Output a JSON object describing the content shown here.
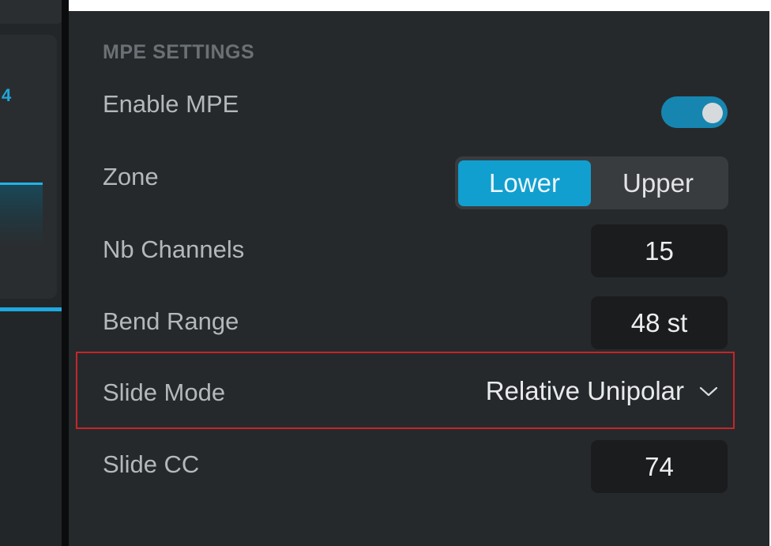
{
  "left_strip": {
    "visible_digit": "4"
  },
  "section": {
    "title": "MPE SETTINGS"
  },
  "rows": {
    "enable_mpe": {
      "label": "Enable MPE",
      "enabled": true
    },
    "zone": {
      "label": "Zone",
      "options": [
        "Lower",
        "Upper"
      ],
      "selected": "Lower"
    },
    "nb_channels": {
      "label": "Nb Channels",
      "value": "15"
    },
    "bend_range": {
      "label": "Bend Range",
      "value": "48 st"
    },
    "slide_mode": {
      "label": "Slide Mode",
      "value": "Relative Unipolar",
      "icon": "chevron-down-icon"
    },
    "slide_cc": {
      "label": "Slide CC",
      "value": "74"
    }
  },
  "colors": {
    "accent": "#119fcf",
    "toggle_on": "#1686b0",
    "highlight_border": "#c4262b",
    "panel_bg": "#26292b"
  }
}
